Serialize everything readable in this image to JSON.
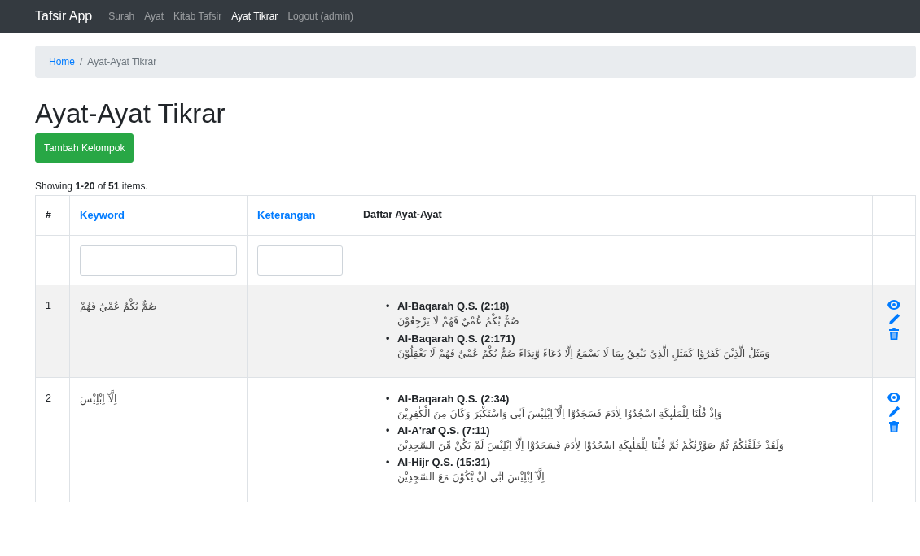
{
  "navbar": {
    "brand": "Tafsir App",
    "items": [
      {
        "label": "Surah",
        "active": false
      },
      {
        "label": "Ayat",
        "active": false
      },
      {
        "label": "Kitab Tafsir",
        "active": false
      },
      {
        "label": "Ayat Tikrar",
        "active": true
      },
      {
        "label": "Logout (admin)",
        "active": false
      }
    ]
  },
  "breadcrumb": {
    "home": "Home",
    "separator": "/",
    "current": "Ayat-Ayat Tikrar"
  },
  "title": "Ayat-Ayat Tikrar",
  "add_button": "Tambah Kelompok",
  "summary": "Showing **1-20** of **51** items.",
  "table": {
    "columns": [
      {
        "label": "#",
        "sortable": false
      },
      {
        "label": "Keyword",
        "sortable": true
      },
      {
        "label": "Keterangan",
        "sortable": true
      },
      {
        "label": "Daftar Ayat-Ayat",
        "sortable": false
      }
    ],
    "filters": [
      {
        "kind": "text"
      },
      {
        "kind": "text"
      }
    ],
    "rows": [
      {
        "number": "1",
        "keyword": "صُمٌّ بُكْمٌ عُمْيٌ فَهُمْ",
        "keterangan": "",
        "ayat": [
          {
            "bullet": "•",
            "ref": "Al-Baqarah Q.S. (2:18)",
            "text": "صُمٌّ بُكْمٌ عُمْيٌ فَهُمْ لَا يَرْجِعُوْنَ"
          },
          {
            "bullet": "•",
            "ref": "Al-Baqarah Q.S. (2:171)",
            "text": "وَمَثَلُ الَّذِيْنَ كَفَرُوْا كَمَثَلِ الَّذِيْ يَنْعِقُ بِمَا لَا يَسْمَعُ اِلَّا دُعَاءً وَّنِدَاءً صُمٌّ بُكْمٌ عُمْيٌ فَهُمْ لَا يَعْقِلُوْنَ"
          }
        ]
      },
      {
        "number": "2",
        "keyword": "اِلَّآ اِبْلِيْسَ",
        "keterangan": "",
        "ayat": [
          {
            "bullet": "•",
            "ref": "Al-Baqarah Q.S. (2:34)",
            "text": "وَاِذْ قُلْنَا لِلْمَلٰىِٕكَةِ اسْجُدُوْا لِاٰدَمَ فَسَجَدُوْٓا اِلَّآ اِبْلِيْسَ اَبٰى وَاسْتَكْبَرَ وَكَانَ مِنَ الْكٰفِرِيْنَ"
          },
          {
            "bullet": "•",
            "ref": "Al-A'raf Q.S. (7:11)",
            "text": "وَلَقَدْ خَلَقْنٰكُمْ ثُمَّ صَوَّرْنٰكُمْ ثُمَّ قُلْنَا لِلْمَلٰىِٕكَةِ اسْجُدُوْا لِاٰدَمَ فَسَجَدُوْٓا اِلَّآ اِبْلِيْسَ لَمْ يَكُنْ مِّنَ السّٰجِدِيْنَ"
          },
          {
            "bullet": "•",
            "ref": "Al-Hijr Q.S. (15:31)",
            "text": "اِلَّآ اِبْلِيْسَ اَبٰٓى اَنْ يَّكُوْنَ مَعَ السّٰجِدِيْنَ"
          }
        ]
      }
    ]
  }
}
